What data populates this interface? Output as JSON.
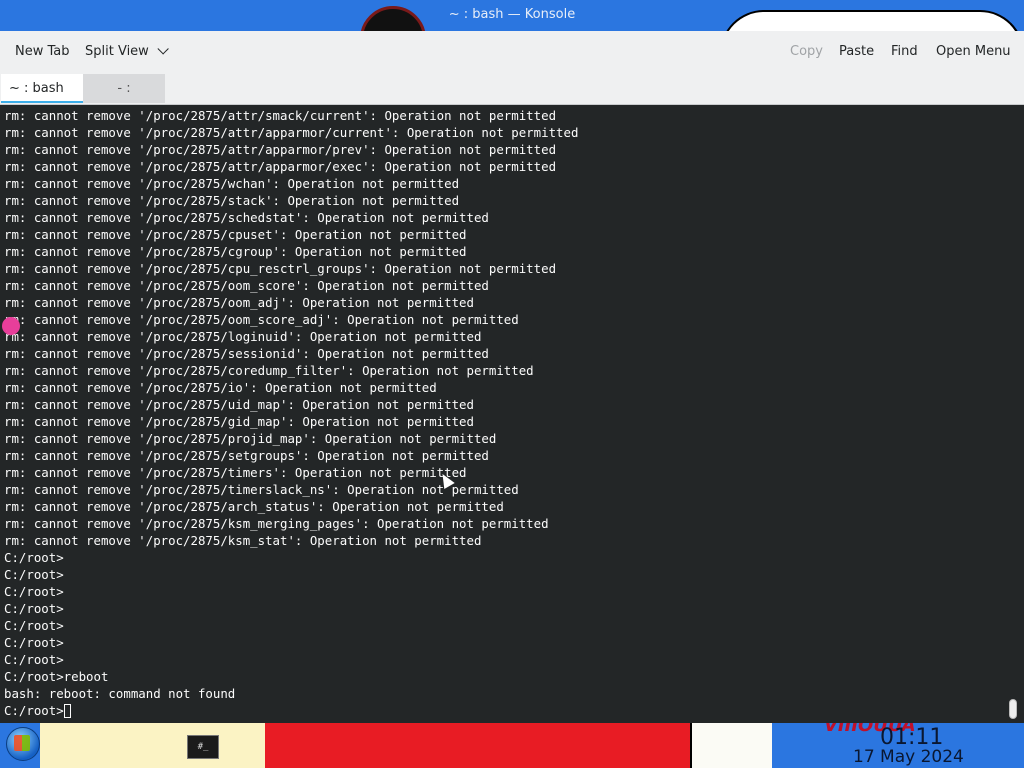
{
  "window": {
    "title": "~ : bash — Konsole"
  },
  "toolbar": {
    "new_tab": "New Tab",
    "split_view": "Split View",
    "copy": "Copy",
    "paste": "Paste",
    "find": "Find",
    "open_menu": "Open Menu"
  },
  "tabs": [
    {
      "label": "~ : bash",
      "active": true
    },
    {
      "label": "- :",
      "active": false
    }
  ],
  "terminal": {
    "lines": [
      "rm: cannot remove '/proc/2875/attr/smack/current': Operation not permitted",
      "rm: cannot remove '/proc/2875/attr/apparmor/current': Operation not permitted",
      "rm: cannot remove '/proc/2875/attr/apparmor/prev': Operation not permitted",
      "rm: cannot remove '/proc/2875/attr/apparmor/exec': Operation not permitted",
      "rm: cannot remove '/proc/2875/wchan': Operation not permitted",
      "rm: cannot remove '/proc/2875/stack': Operation not permitted",
      "rm: cannot remove '/proc/2875/schedstat': Operation not permitted",
      "rm: cannot remove '/proc/2875/cpuset': Operation not permitted",
      "rm: cannot remove '/proc/2875/cgroup': Operation not permitted",
      "rm: cannot remove '/proc/2875/cpu_resctrl_groups': Operation not permitted",
      "rm: cannot remove '/proc/2875/oom_score': Operation not permitted",
      "rm: cannot remove '/proc/2875/oom_adj': Operation not permitted",
      "rm: cannot remove '/proc/2875/oom_score_adj': Operation not permitted",
      "rm: cannot remove '/proc/2875/loginuid': Operation not permitted",
      "rm: cannot remove '/proc/2875/sessionid': Operation not permitted",
      "rm: cannot remove '/proc/2875/coredump_filter': Operation not permitted",
      "rm: cannot remove '/proc/2875/io': Operation not permitted",
      "rm: cannot remove '/proc/2875/uid_map': Operation not permitted",
      "rm: cannot remove '/proc/2875/gid_map': Operation not permitted",
      "rm: cannot remove '/proc/2875/projid_map': Operation not permitted",
      "rm: cannot remove '/proc/2875/setgroups': Operation not permitted",
      "rm: cannot remove '/proc/2875/timers': Operation not permitted",
      "rm: cannot remove '/proc/2875/timerslack_ns': Operation not permitted",
      "rm: cannot remove '/proc/2875/arch_status': Operation not permitted",
      "rm: cannot remove '/proc/2875/ksm_merging_pages': Operation not permitted",
      "rm: cannot remove '/proc/2875/ksm_stat': Operation not permitted",
      "C:/root>",
      "C:/root>",
      "C:/root>",
      "C:/root>",
      "C:/root>",
      "C:/root>",
      "C:/root>",
      "C:/root>reboot",
      "bash: reboot: command not found"
    ],
    "prompt": "C:/root>"
  },
  "taskbar": {
    "app_label": "#_",
    "clock_time": "01:11",
    "clock_date": "17 May 2024",
    "wallpaper_text": "VIIIOUUA"
  },
  "colors": {
    "terminal_bg": "#232627",
    "terminal_fg": "#fcfcfc",
    "chrome_bg": "#eff0f1",
    "accent": "#3daee9"
  }
}
